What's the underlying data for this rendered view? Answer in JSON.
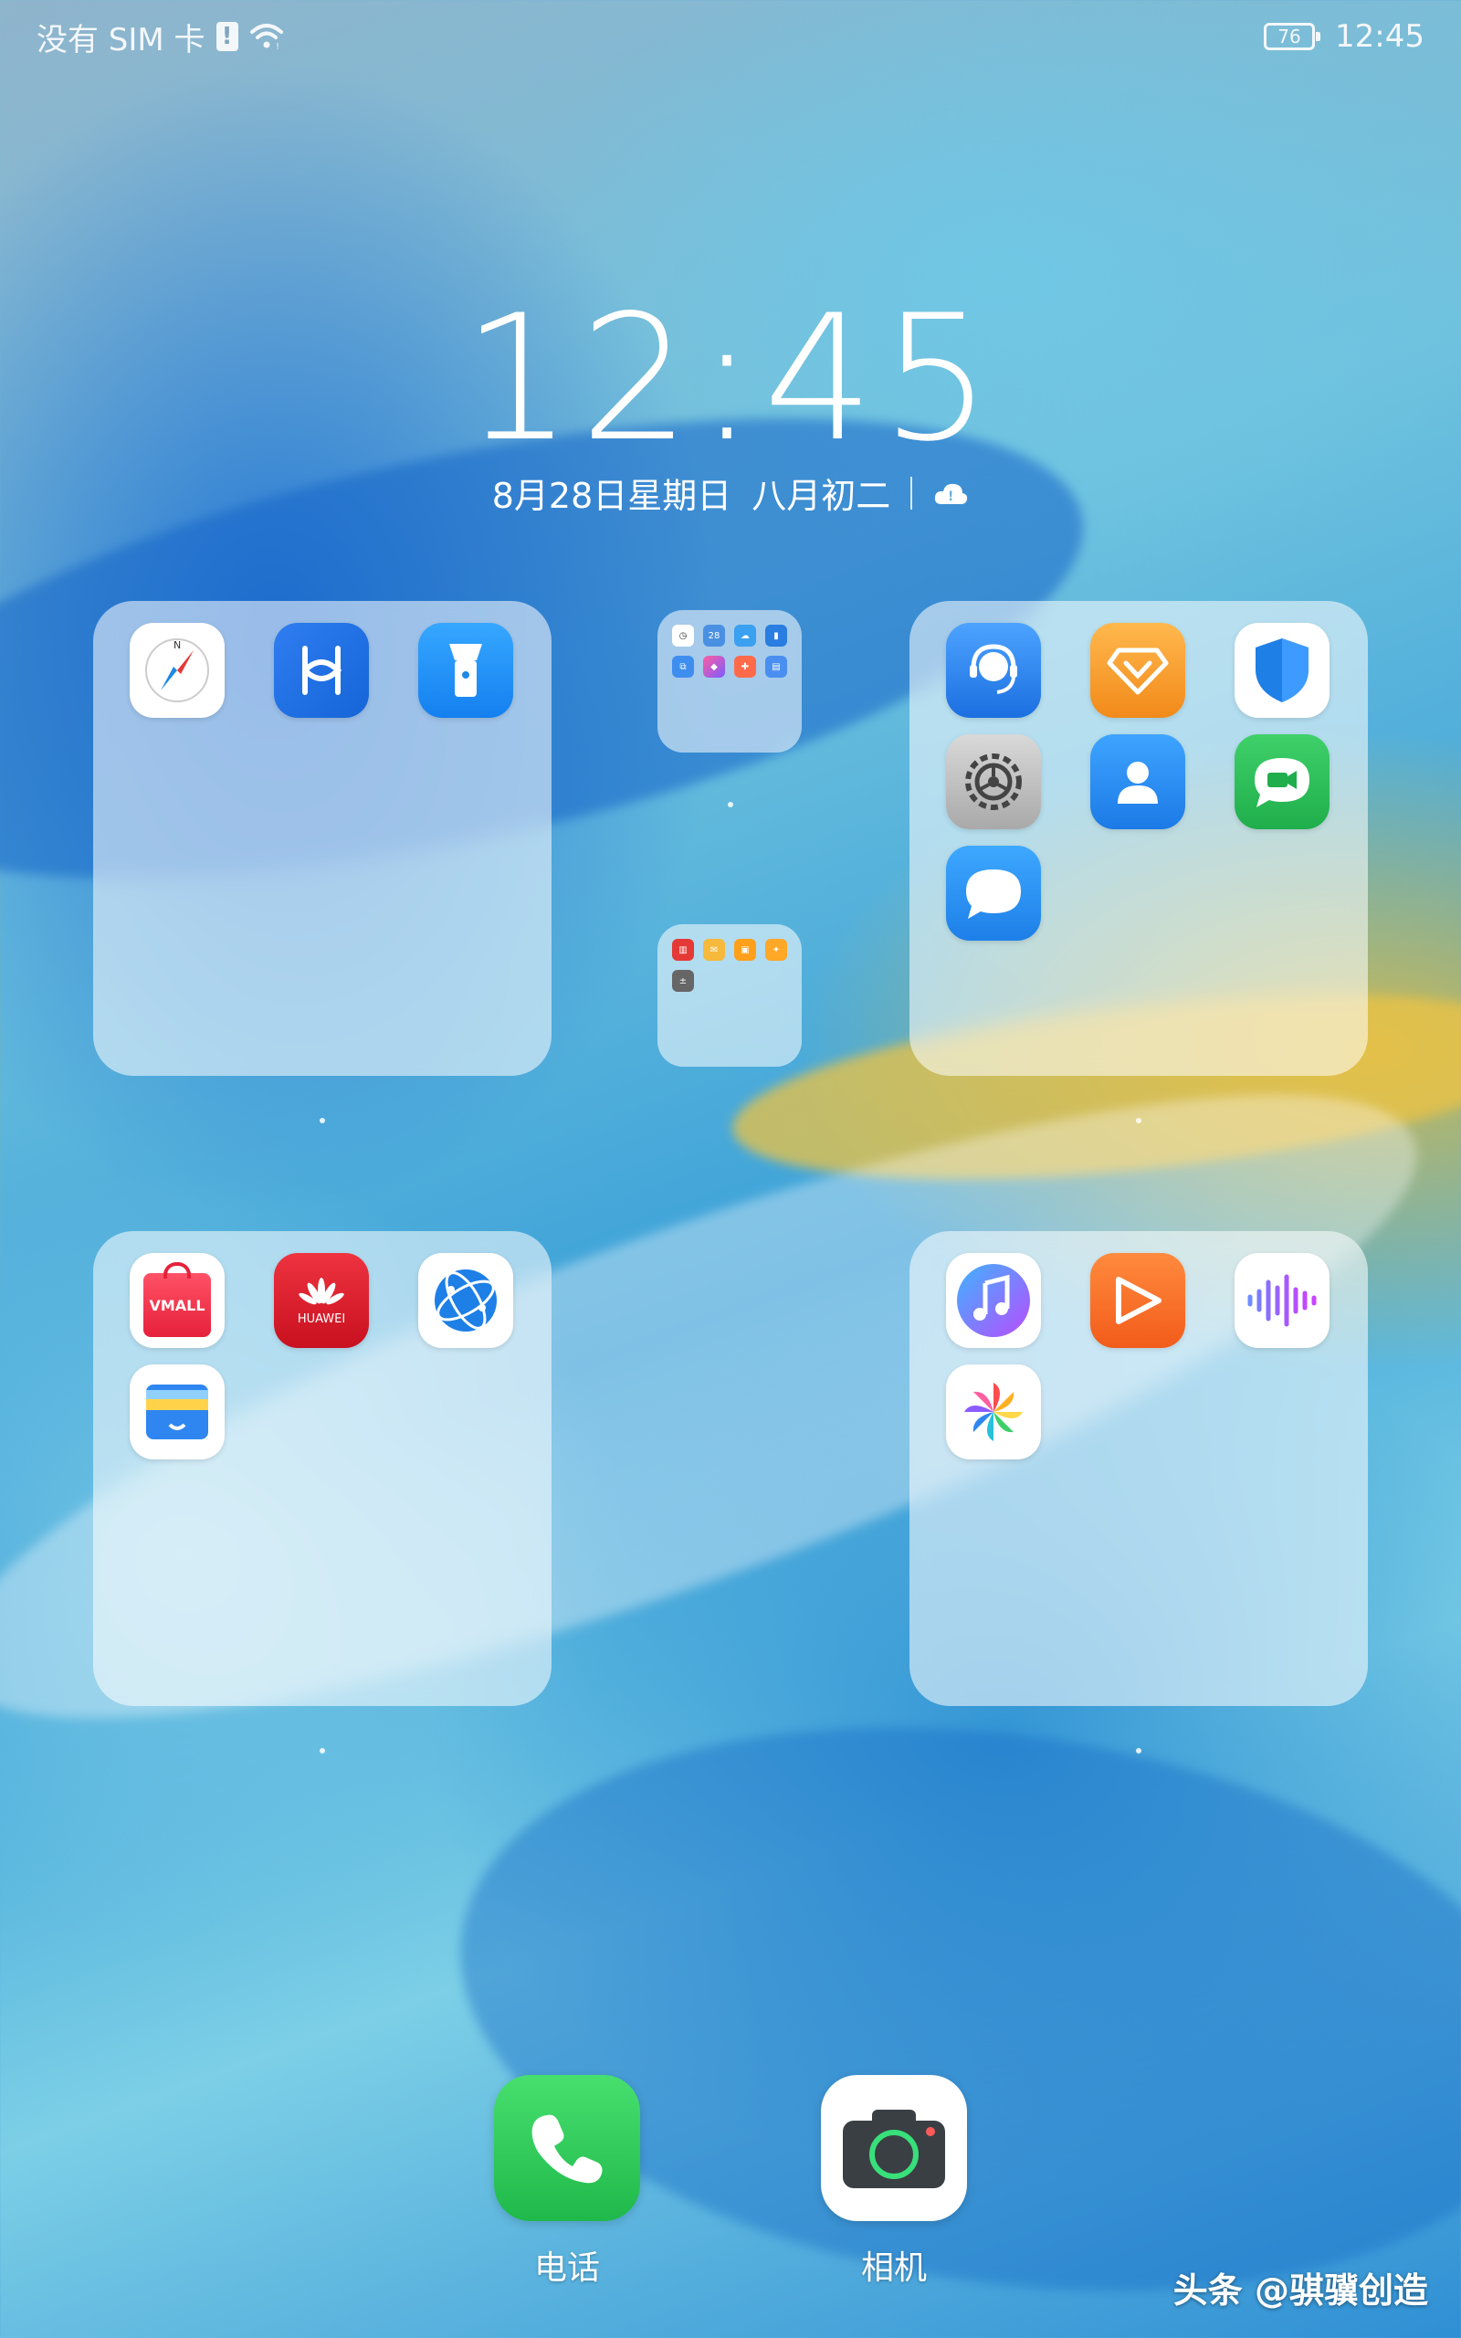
{
  "status_bar": {
    "sim_text": "没有 SIM 卡",
    "battery_level": "76",
    "time": "12:45"
  },
  "lock": {
    "clock": "12:45",
    "date": "8月28日星期日",
    "lunar_date": "八月初二"
  },
  "icons": {
    "compass": "compass-icon",
    "harmony": "huawei-share-icon",
    "flashlight": "flashlight-icon",
    "support": "customer-service-icon",
    "member": "huawei-member-icon",
    "security": "phone-manager-icon",
    "settings": "settings-icon",
    "contacts": "contacts-icon",
    "meetime": "meetime-icon",
    "messages": "messages-icon",
    "vmall": "vmall-icon",
    "huawei_store": "huawei-appgallery-icon",
    "browser": "browser-icon",
    "wallet": "wallet-icon",
    "music": "music-icon",
    "video": "video-icon",
    "recorder": "recorder-icon",
    "gallery": "gallery-icon"
  },
  "app_text": {
    "vmall": "VMALL",
    "huawei": "HUAWEI"
  },
  "dock": {
    "phone_label": "电话",
    "camera_label": "相机"
  },
  "watermark": "头条 @骐骥创造",
  "colors": {
    "accent_blue": "#1e88e5",
    "gold": "#e6b93c",
    "green": "#2dc653"
  }
}
